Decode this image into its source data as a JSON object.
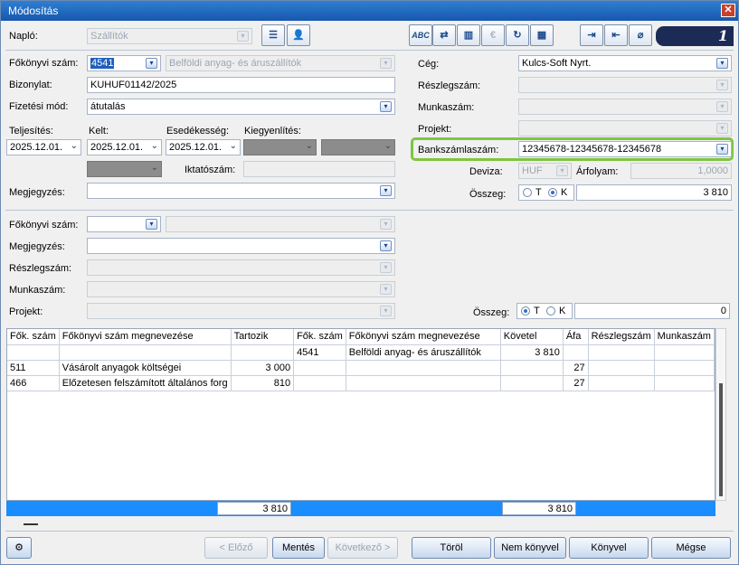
{
  "window": {
    "title": "Módosítás"
  },
  "toolbar": {
    "naplo_label": "Napló:",
    "naplo_value": "Szállítók",
    "icons": [
      "list-icon",
      "user-icon",
      "spellcheck-icon",
      "transfer-icon",
      "chart-icon",
      "euro-icon",
      "refresh-icon",
      "calendar-icon",
      "import-icon",
      "export-icon",
      "attach-icon"
    ],
    "abc_label": "ABC",
    "euro_label": "€",
    "counter": "1"
  },
  "header": {
    "fokonyvi_label": "Főkönyvi szám:",
    "fokonyvi_code": "4541",
    "fokonyvi_name": "Belföldi anyag- és áruszállítók",
    "bizonylat_label": "Bizonylat:",
    "bizonylat_value": "KUHUF01142/2025",
    "fizetesi_label": "Fizetési mód:",
    "fizetesi_value": "átutalás",
    "teljesites_label": "Teljesítés:",
    "teljesites_value": "2025.12.01.",
    "kelt_label": "Kelt:",
    "kelt_value": "2025.12.01.",
    "esedekesseg_label": "Esedékesség:",
    "esedekesseg_value": "2025.12.01.",
    "kiegyenlites_label": "Kiegyenlítés:",
    "iktatoszam_label": "Iktatószám:",
    "megjegyzes_label": "Megjegyzés:",
    "ceg_label": "Cég:",
    "ceg_value": "Kulcs-Soft Nyrt.",
    "reszleg_label": "Részlegszám:",
    "munkaszam_label": "Munkaszám:",
    "projekt_label": "Projekt:",
    "bankszamla_label": "Bankszámlaszám:",
    "bankszamla_value": "12345678-12345678-12345678",
    "deviza_label": "Deviza:",
    "deviza_value": "HUF",
    "arfolyam_label": "Árfolyam:",
    "arfolyam_value": "1,0000",
    "osszeg_label": "Összeg:",
    "osszeg_value": "3 810",
    "radio_t": "T",
    "radio_k": "K"
  },
  "lower": {
    "fokonyvi_label": "Főkönyvi szám:",
    "megjegyzes_label": "Megjegyzés:",
    "reszleg_label": "Részlegszám:",
    "munkaszam_label": "Munkaszám:",
    "projekt_label": "Projekt:",
    "osszeg_label": "Összeg:",
    "osszeg_value": "0",
    "radio_t": "T",
    "radio_k": "K"
  },
  "grid": {
    "columns": [
      "Fők. szám",
      "Főkönyvi szám megnevezése",
      "Tartozik",
      "Fők. szám",
      "Főkönyvi szám megnevezése",
      "Követel",
      "Áfa",
      "Részlegszám",
      "Munkaszám"
    ],
    "rows": [
      [
        "",
        "",
        "",
        "4541",
        "Belföldi anyag- és áruszállítók",
        "3 810",
        "",
        "",
        ""
      ],
      [
        "511",
        "Vásárolt anyagok költségei",
        "3 000",
        "",
        "",
        "",
        "27",
        "",
        ""
      ],
      [
        "466",
        "Előzetesen felszámított általános forg",
        "810",
        "",
        "",
        "",
        "27",
        "",
        ""
      ]
    ],
    "sum_tartozik": "3 810",
    "sum_kovetel": "3 810"
  },
  "footer": {
    "prev": "< Előző",
    "save": "Mentés",
    "next": "Következő >",
    "delete": "Töröl",
    "no_book": "Nem könyvel",
    "book": "Könyvel",
    "cancel": "Mégse"
  }
}
